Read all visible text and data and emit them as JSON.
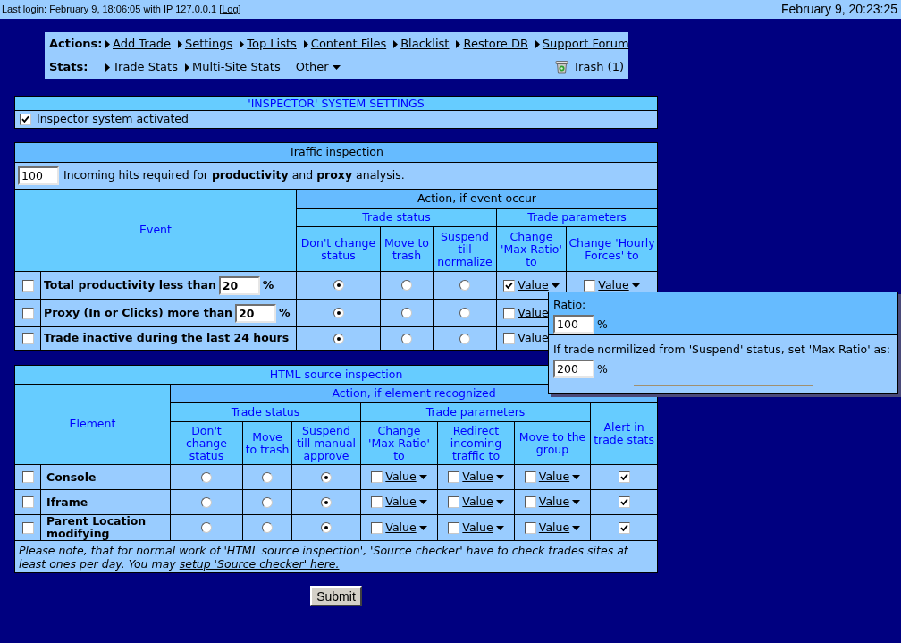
{
  "top_bar": {
    "login_before": "Last login: February 9, 18:06:05 with IP 127.0.0.1 [",
    "log_link": "Log",
    "login_after": "]",
    "datetime": "February 9, 20:23:25"
  },
  "nav": [
    {
      "label": "Actions:",
      "items": [
        {
          "kind": "link",
          "label": "Add Trade"
        },
        {
          "kind": "link",
          "label": "Settings"
        },
        {
          "kind": "link",
          "label": "Top Lists"
        },
        {
          "kind": "link",
          "label": "Content Files"
        },
        {
          "kind": "link",
          "label": "Blacklist"
        },
        {
          "kind": "link",
          "label": "Restore DB"
        },
        {
          "kind": "link",
          "label": "Support Forum"
        }
      ]
    },
    {
      "label": "Stats:",
      "items": [
        {
          "kind": "link",
          "label": "Trade Stats"
        },
        {
          "kind": "link",
          "label": "Multi-Site Stats"
        },
        {
          "kind": "menu",
          "label": "Other"
        },
        {
          "kind": "trash",
          "label": "Trash (1)"
        }
      ]
    }
  ],
  "inspector_settings": {
    "title": "'INSPECTOR' SYSTEM SETTINGS",
    "activated": {
      "label": "Inspector system activated",
      "checked": true
    }
  },
  "traffic_inspection": {
    "title": "Traffic inspection",
    "hits": {
      "value": "100",
      "text": "Incoming hits required for **productivity** and **proxy** analysis."
    },
    "event_header": "Event",
    "action_header": "Action, if event occur",
    "status_group": "Trade status",
    "params_group": "Trade parameters",
    "status_columns": [
      "Don't change status",
      "Move to trash",
      "Suspend till normalize"
    ],
    "param_columns": [
      "Change 'Max Ratio' to",
      "Change 'Hourly Forces' to"
    ],
    "rows": [
      {
        "kind": "threshold",
        "checked": false,
        "label": "Total productivity less than",
        "value": "20",
        "unit": "%",
        "status": [
          {
            "selected": true
          },
          {
            "selected": false
          },
          {
            "selected": false
          }
        ],
        "params": [
          {
            "label": "Value",
            "checked": true
          },
          {
            "label": "Value",
            "checked": false
          }
        ]
      },
      {
        "kind": "threshold",
        "checked": false,
        "label": "Proxy (In or Clicks) more than",
        "value": "20",
        "unit": "%",
        "status": [
          {
            "selected": true
          },
          {
            "selected": false
          },
          {
            "selected": false
          }
        ],
        "params": [
          {
            "label": "Value",
            "checked": false
          }
        ]
      },
      {
        "kind": "plain",
        "checked": false,
        "label": "Trade inactive during the last 24 hours",
        "status": [
          {
            "selected": true
          },
          {
            "selected": false
          },
          {
            "selected": false
          }
        ],
        "params": [
          {
            "label": "Value",
            "checked": false
          }
        ]
      }
    ]
  },
  "ratio_popup": {
    "ratio_label": "Ratio:",
    "ratio_value": "100",
    "ratio_unit": "%",
    "normalize_label": "If trade normilized from 'Suspend' status, set 'Max Ratio' as:",
    "normalize_value": "200",
    "normalize_unit": "%"
  },
  "html_inspection": {
    "title": "HTML source inspection",
    "element_header": "Element",
    "action_header": "Action, if element recognized",
    "status_group": "Trade status",
    "params_group": "Trade parameters",
    "status_columns": [
      "Don't change status",
      "Move to trash",
      "Suspend till manual approve"
    ],
    "param_columns": [
      "Change 'Max Ratio' to",
      "Redirect incoming traffic to",
      "Move to the group"
    ],
    "alert_header": "Alert in trade stats",
    "rows": [
      {
        "checked": false,
        "label": "Console",
        "status": [
          {
            "selected": false
          },
          {
            "selected": false
          },
          {
            "selected": true
          }
        ],
        "params": [
          {
            "label": "Value",
            "checked": false
          },
          {
            "label": "Value",
            "checked": false
          },
          {
            "label": "Value",
            "checked": false
          }
        ],
        "alert": true
      },
      {
        "checked": false,
        "label": "Iframe",
        "status": [
          {
            "selected": false
          },
          {
            "selected": false
          },
          {
            "selected": true
          }
        ],
        "params": [
          {
            "label": "Value",
            "checked": false
          },
          {
            "label": "Value",
            "checked": false
          },
          {
            "label": "Value",
            "checked": false
          }
        ],
        "alert": true
      },
      {
        "checked": false,
        "label": "Parent Location modifying",
        "status": [
          {
            "selected": false
          },
          {
            "selected": false
          },
          {
            "selected": true
          }
        ],
        "params": [
          {
            "label": "Value",
            "checked": false
          },
          {
            "label": "Value",
            "checked": false
          },
          {
            "label": "Value",
            "checked": false
          }
        ],
        "alert": true
      }
    ],
    "note": "Please note, that for normal work of 'HTML source inspection', 'Source checker' have to check trades sites at least ones per day. You may",
    "note_link": "setup 'Source checker' here."
  },
  "submit_label": "Submit"
}
